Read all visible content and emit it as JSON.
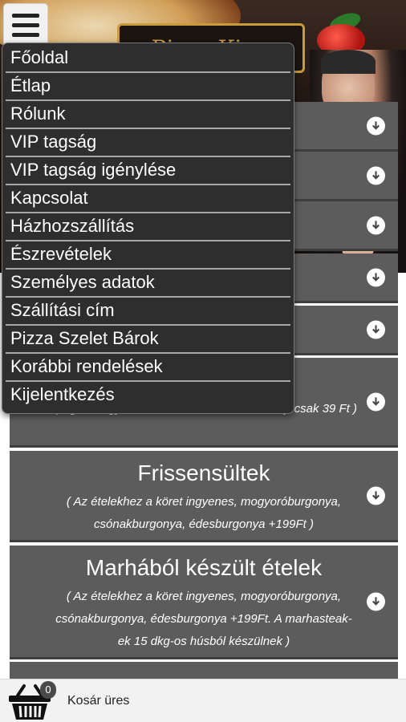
{
  "header": {
    "logo_text": "Pizza King"
  },
  "side_menu": {
    "items": [
      "Főoldal",
      "Étlap",
      "Rólunk",
      "VIP tagság",
      "VIP tagság igénylése",
      "Kapcsolat",
      "Házhozszállítás",
      "Észrevételek",
      "Személyes adatok",
      "Szállítási cím",
      "Pizza Szelet Bárok",
      "Korábbi rendelések",
      "Kijelentkezés"
    ]
  },
  "categories": [
    {
      "title": "",
      "desc": ""
    },
    {
      "title": "",
      "desc": ""
    },
    {
      "title": "",
      "desc": ""
    },
    {
      "title": "",
      "desc": ""
    },
    {
      "title": "",
      "desc": ""
    },
    {
      "title": "",
      "desc": "spagetti vagy fussili tésztából is, Az extra sajt csak 39 Ft )"
    },
    {
      "title": "Frissensültek",
      "desc": "( Az ételekhez a köret ingyenes, mogyoróburgonya, csónakburgonya, édesburgonya +199Ft )"
    },
    {
      "title": "Marhából készült ételek",
      "desc": "( Az ételekhez a köret ingyenes, mogyoróburgonya, csónakburgonya, édesburgonya +199Ft. A marhasteak-ek 15 dkg-os húsból készülnek )"
    }
  ],
  "cart": {
    "count": "0",
    "label": "Kosár üres"
  },
  "colors": {
    "category_bg": "#5c5c5c",
    "menu_bg": "#2e2e2e",
    "logo_gold": "#c89b3c"
  }
}
